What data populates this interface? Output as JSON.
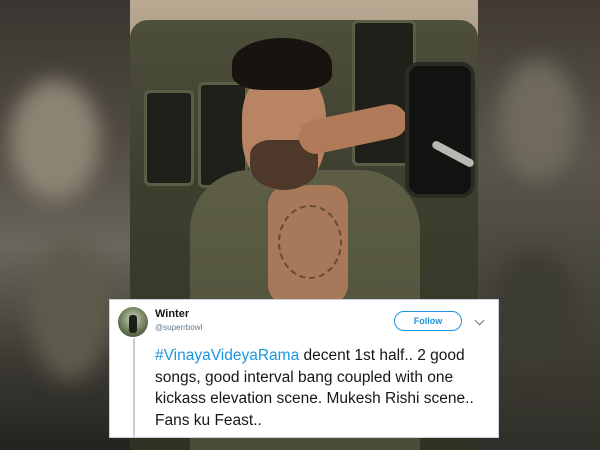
{
  "tweet": {
    "user_name": "Winter",
    "user_handle": "@superrbowl",
    "follow_label": "Follow",
    "hashtag": "#VinayaVideyaRama",
    "text": " decent 1st half.. 2 good songs, good interval bang coupled with one kickass elevation scene. Mukesh Rishi scene.. Fans ku Feast.."
  },
  "icons": {
    "avatar": "profile-photo",
    "menu": "chevron-down-icon"
  },
  "colors": {
    "link": "#1b95e0",
    "text": "#14171a",
    "muted": "#657786"
  }
}
